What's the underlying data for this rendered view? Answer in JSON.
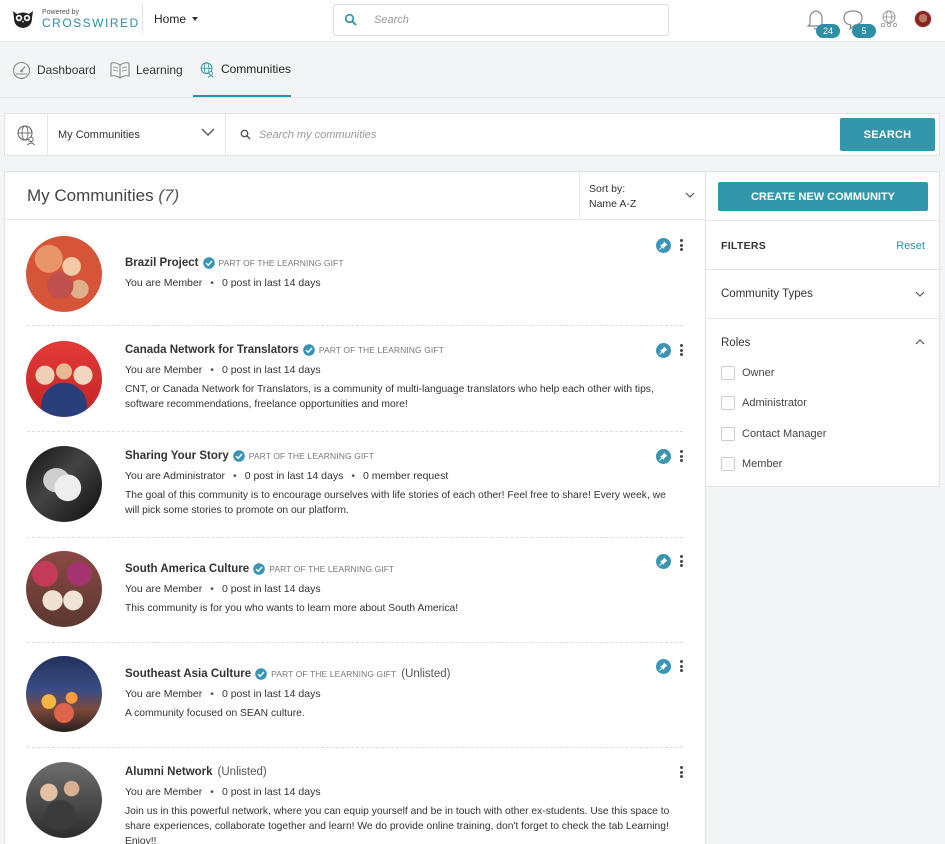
{
  "header": {
    "logo_powered": "Powered by",
    "logo_brand": "CROSSWIRED",
    "home_label": "Home",
    "search_placeholder": "Search",
    "notifications_count": "24",
    "messages_count": "5"
  },
  "tabs": [
    {
      "label": "Dashboard",
      "icon": "dashboard-icon"
    },
    {
      "label": "Learning",
      "icon": "book-icon"
    },
    {
      "label": "Communities",
      "icon": "globe-people-icon",
      "active": true
    }
  ],
  "filterbar": {
    "scope_selected": "My Communities",
    "search_placeholder": "Search my communities",
    "search_button": "SEARCH"
  },
  "main": {
    "title": "My Communities",
    "count": "(7)",
    "sort_label": "Sort by:",
    "sort_value": "Name A-Z"
  },
  "communities": [
    {
      "name": "Brazil Project",
      "verified": true,
      "gift": "PART OF THE LEARNING GIFT",
      "unlisted": "",
      "role": "You are Member",
      "posts": "0 post in last 14 days",
      "requests": "",
      "description": "",
      "pinned": true
    },
    {
      "name": "Canada Network for Translators",
      "verified": true,
      "gift": "PART OF THE LEARNING GIFT",
      "unlisted": "",
      "role": "You are Member",
      "posts": "0 post in last 14 days",
      "requests": "",
      "description": "CNT, or Canada Network for Translators, is a community of multi-language translators who help each other with tips, software recommendations, freelance opportunities and more!",
      "pinned": true
    },
    {
      "name": "Sharing Your Story",
      "verified": true,
      "gift": "PART OF THE LEARNING GIFT",
      "unlisted": "",
      "role": "You are Administrator",
      "posts": "0 post in last 14 days",
      "requests": "0 member request",
      "description": "The goal of this community is to encourage ourselves with life stories of each other! Feel free to share! Every week, we will pick some stories to promote on our platform.",
      "pinned": true
    },
    {
      "name": "South America Culture",
      "verified": true,
      "gift": "PART OF THE LEARNING GIFT",
      "unlisted": "",
      "role": "You are Member",
      "posts": "0 post in last 14 days",
      "requests": "",
      "description": "This community is for you who wants to learn more about South America!",
      "pinned": true
    },
    {
      "name": "Southeast Asia Culture",
      "verified": true,
      "gift": "PART OF THE LEARNING GIFT",
      "unlisted": "(Unlisted)",
      "role": "You are Member",
      "posts": "0 post in last 14 days",
      "requests": "",
      "description": "A community focused on SEAN culture.",
      "pinned": true
    },
    {
      "name": "Alumni Network",
      "verified": false,
      "gift": "",
      "unlisted": "(Unlisted)",
      "role": "You are Member",
      "posts": "0 post in last 14 days",
      "requests": "",
      "description": "Join us in this powerful network, where you can equip yourself and be in touch with other ex-students. Use this space to share experiences, collaborate together and learn! We do provide online training, don't forget to check the tab Learning! Enjoy!!",
      "pinned": false
    }
  ],
  "sidebar": {
    "create_button": "CREATE NEW COMMUNITY",
    "filters_title": "FILTERS",
    "reset_label": "Reset",
    "community_types_label": "Community Types",
    "roles_label": "Roles",
    "roles": [
      "Owner",
      "Administrator",
      "Contact Manager",
      "Member"
    ]
  },
  "colors": {
    "accent": "#3397ab",
    "link": "#2d8fa5"
  }
}
